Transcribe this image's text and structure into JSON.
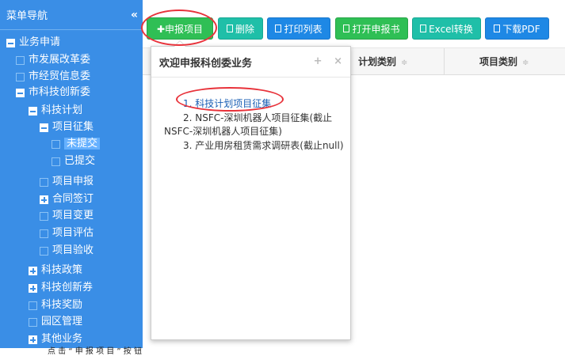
{
  "sidebar": {
    "title": "菜单导航",
    "collapse": "«",
    "items": [
      {
        "label": "业务申请",
        "type": "minus"
      },
      {
        "label": "市发展改革委",
        "type": "leaf"
      },
      {
        "label": "市经贸信息委",
        "type": "leaf"
      },
      {
        "label": "市科技创新委",
        "type": "minus"
      },
      {
        "label": "科技计划",
        "type": "minus"
      },
      {
        "label": "项目征集",
        "type": "minus"
      },
      {
        "label": "未提交",
        "type": "leaf"
      },
      {
        "label": "已提交",
        "type": "leaf"
      },
      {
        "label": "项目申报",
        "type": "leaf"
      },
      {
        "label": "合同签订",
        "type": "plus"
      },
      {
        "label": "项目变更",
        "type": "leaf"
      },
      {
        "label": "项目评估",
        "type": "leaf"
      },
      {
        "label": "项目验收",
        "type": "leaf"
      },
      {
        "label": "科技政策",
        "type": "plus"
      },
      {
        "label": "科技创新券",
        "type": "plus"
      },
      {
        "label": "科技奖励",
        "type": "leaf"
      },
      {
        "label": "园区管理",
        "type": "leaf"
      },
      {
        "label": "其他业务",
        "type": "plus"
      }
    ]
  },
  "toolbar": {
    "apply": "✚申报项目",
    "delete": "删除",
    "print_list": "打印列表",
    "open_apply": "打开申报书",
    "excel": "Excel转换",
    "pdf": "下载PDF"
  },
  "table": {
    "col_plan_type": "计划类别",
    "col_project_type": "项目类别",
    "sort_glyph": "≑"
  },
  "popover": {
    "title": "欢迎申报科创委业务",
    "add": "+",
    "close": "×",
    "item1": "1. 科技计划项目征集",
    "item2_line1": "2. NSFC-深圳机器人项目征集(截止",
    "item2_line2": "NSFC-深圳机器人项目征集)",
    "item3": "3. 产业用房租赁需求调研表(截止null)"
  },
  "bottom_note": "点 击 “ 申 报 项 目 ” 按 钮"
}
